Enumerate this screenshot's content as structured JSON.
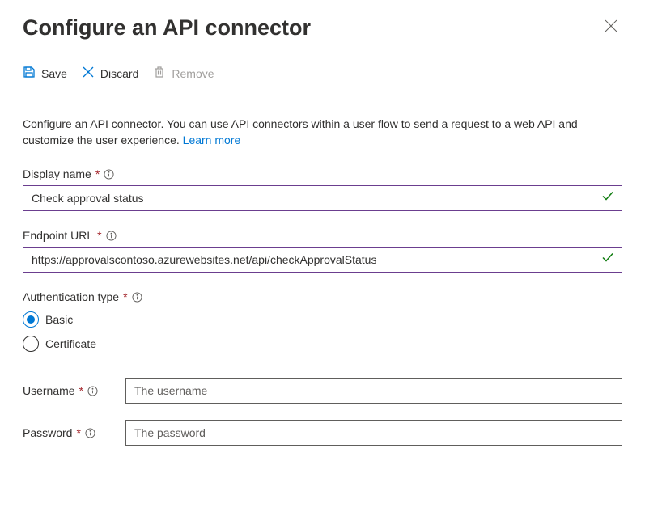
{
  "page": {
    "title": "Configure an API connector"
  },
  "toolbar": {
    "save_label": "Save",
    "discard_label": "Discard",
    "remove_label": "Remove"
  },
  "description": {
    "text": "Configure an API connector. You can use API connectors within a user flow to send a request to a web API and customize the user experience. ",
    "link_text": "Learn more"
  },
  "fields": {
    "display_name": {
      "label": "Display name",
      "value": "Check approval status"
    },
    "endpoint_url": {
      "label": "Endpoint URL",
      "value": "https://approvalscontoso.azurewebsites.net/api/checkApprovalStatus"
    },
    "auth_type": {
      "label": "Authentication type",
      "options": {
        "basic": "Basic",
        "certificate": "Certificate"
      },
      "selected": "basic"
    },
    "username": {
      "label": "Username",
      "placeholder": "The username"
    },
    "password": {
      "label": "Password",
      "placeholder": "The password"
    }
  }
}
